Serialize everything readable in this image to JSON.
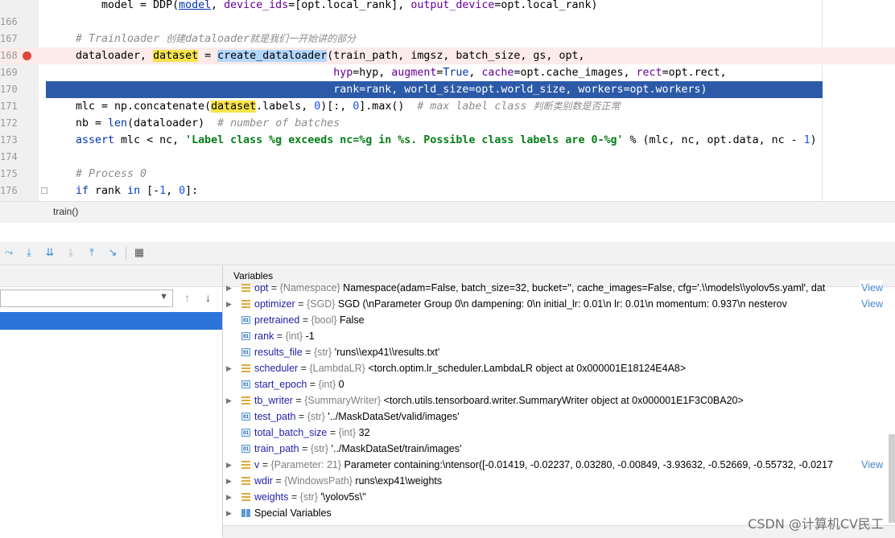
{
  "editor": {
    "lines": [
      {
        "no": "",
        "html": "    model = DDP(<span class='ul'>model</span>, <span class='par'>device_ids</span>=[opt.local_rank], <span class='par'>output_device</span>=opt.local_rank)"
      },
      {
        "no": "166",
        "html": ""
      },
      {
        "no": "167",
        "html": "<span class='cm'># Trainloader </span><span class='cmcn'>创建</span><span class='cm'>dataloader</span><span class='cmcn'>就是我们一开始讲的部分</span>"
      },
      {
        "no": "168",
        "html": "dataloader, <span class='hl-y'>dataset</span> = <span class='hl-b'>create_dataloader</span>(train_path, imgsz, batch_size, gs, opt,"
      },
      {
        "no": "169",
        "html": "                                        <span class='par'>hyp</span>=hyp, <span class='par'>augment</span>=<span class='kw'>True</span>, <span class='par'>cache</span>=opt.cache_images, <span class='par'>rect</span>=opt.rect,"
      },
      {
        "no": "170",
        "html": "                                        rank=rank, world_size=opt.world_size, workers=opt.workers)"
      },
      {
        "no": "171",
        "html": "mlc = np.concatenate(<span class='hl-y'>dataset</span>.labels, <span class='num'>0</span>)[:, <span class='num'>0</span>].max()  <span class='cm'># max label class </span><span class='cmcn'>判断类别数是否正常</span>"
      },
      {
        "no": "172",
        "html": "nb = <span class='kw'>len</span>(dataloader)  <span class='cm'># number of batches</span>"
      },
      {
        "no": "173",
        "html": "<span class='kw'>assert</span> mlc &lt; nc, <span class='str'>'Label class %g exceeds nc=%g in %s. Possible class labels are 0-%g'</span> % (mlc, nc, opt.data, nc - <span class='num'>1</span>)"
      },
      {
        "no": "174",
        "html": ""
      },
      {
        "no": "175",
        "html": "<span class='cm'># Process 0</span>"
      },
      {
        "no": "176",
        "html": "<span class='kw'>if</span> rank <span class='kw'>in</span> [-<span class='num'>1</span>, <span class='num'>0</span>]:"
      }
    ]
  },
  "breadcrumb": {
    "label": "train()"
  },
  "variables": {
    "header": "Variables",
    "view_label": "View",
    "rows": [
      {
        "icon": "obj",
        "expand": true,
        "name": "opt",
        "type": "{Namespace}",
        "value": "Namespace(adam=False, batch_size=32, bucket='', cache_images=False, cfg='.\\\\models\\\\yolov5s.yaml', dat",
        "view": true
      },
      {
        "icon": "obj",
        "expand": true,
        "name": "optimizer",
        "type": "{SGD}",
        "value": "SGD (\\nParameter Group 0\\n    dampening: 0\\n    initial_lr: 0.01\\n    lr: 0.01\\n    momentum: 0.937\\n    nesterov",
        "view": true
      },
      {
        "icon": "prim",
        "expand": false,
        "name": "pretrained",
        "type": "{bool}",
        "value": "False",
        "view": false
      },
      {
        "icon": "prim",
        "expand": false,
        "name": "rank",
        "type": "{int}",
        "value": "-1",
        "view": false
      },
      {
        "icon": "prim",
        "expand": false,
        "name": "results_file",
        "type": "{str}",
        "value": "'runs\\\\exp41\\\\results.txt'",
        "view": false
      },
      {
        "icon": "obj",
        "expand": true,
        "name": "scheduler",
        "type": "{LambdaLR}",
        "value": "<torch.optim.lr_scheduler.LambdaLR object at 0x000001E18124E4A8>",
        "view": false
      },
      {
        "icon": "prim",
        "expand": false,
        "name": "start_epoch",
        "type": "{int}",
        "value": "0",
        "view": false
      },
      {
        "icon": "obj",
        "expand": true,
        "name": "tb_writer",
        "type": "{SummaryWriter}",
        "value": "<torch.utils.tensorboard.writer.SummaryWriter object at 0x000001E1F3C0BA20>",
        "view": false
      },
      {
        "icon": "prim",
        "expand": false,
        "name": "test_path",
        "type": "{str}",
        "value": "'../MaskDataSet/valid/images'",
        "view": false
      },
      {
        "icon": "prim",
        "expand": false,
        "name": "total_batch_size",
        "type": "{int}",
        "value": "32",
        "view": false
      },
      {
        "icon": "prim",
        "expand": false,
        "name": "train_path",
        "type": "{str}",
        "value": "'../MaskDataSet/train/images'",
        "view": false
      },
      {
        "icon": "obj",
        "expand": true,
        "name": "v",
        "type": "{Parameter: 21}",
        "value": "Parameter containing:\\ntensor([-0.01419, -0.02237,  0.03280, -0.00849, -3.93632, -0.52669, -0.55732, -0.0217",
        "view": true
      },
      {
        "icon": "obj",
        "expand": true,
        "name": "wdir",
        "type": "{WindowsPath}",
        "value": "runs\\exp41\\weights",
        "view": false
      },
      {
        "icon": "obj",
        "expand": true,
        "name": "weights",
        "type": "{str}",
        "value": "'\\yolov5s\\''",
        "view": false
      },
      {
        "icon": "spec",
        "expand": true,
        "name": "Special Variables",
        "type": "",
        "value": "",
        "view": false
      }
    ]
  },
  "watermark": "CSDN @计算机CV民工"
}
